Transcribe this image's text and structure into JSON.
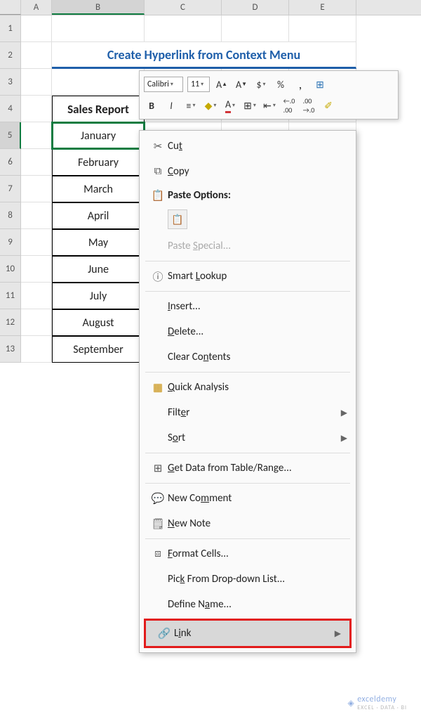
{
  "columns": [
    "A",
    "B",
    "C",
    "D",
    "E"
  ],
  "rows": [
    "1",
    "2",
    "3",
    "4",
    "5",
    "6",
    "7",
    "8",
    "9",
    "10",
    "11",
    "12",
    "13"
  ],
  "active_column": "B",
  "active_row": "5",
  "title": "Create Hyperlink from Context Menu",
  "table": {
    "header": "Sales Report",
    "values": [
      "January",
      "February",
      "March",
      "April",
      "May",
      "June",
      "July",
      "August",
      "September"
    ]
  },
  "mini_toolbar": {
    "font_name": "Calibri",
    "font_size": "11",
    "buttons_row1": [
      "A▲",
      "A▼",
      "$",
      "%",
      ",",
      "⊞"
    ],
    "bold": "B",
    "italic": "I",
    "align": "≡",
    "fill": "◇",
    "font_color": "A",
    "borders": "⊞",
    "merge": "⇤",
    "inc_dec": ".0",
    "dec_dec": ".00",
    "format_painter": "✐"
  },
  "context_menu": {
    "cut": "Cut",
    "copy": "Copy",
    "paste_options": "Paste Options:",
    "paste_special": "Paste Special...",
    "smart_lookup": "Smart Lookup",
    "insert": "Insert...",
    "delete": "Delete...",
    "clear_contents": "Clear Contents",
    "quick_analysis": "Quick Analysis",
    "filter": "Filter",
    "sort": "Sort",
    "get_data": "Get Data from Table/Range...",
    "new_comment": "New Comment",
    "new_note": "New Note",
    "format_cells": "Format Cells...",
    "pick_dropdown": "Pick From Drop-down List...",
    "define_name": "Define Name...",
    "link": "Link"
  },
  "watermark": {
    "brand": "exceldemy",
    "sub": "EXCEL · DATA · BI"
  }
}
